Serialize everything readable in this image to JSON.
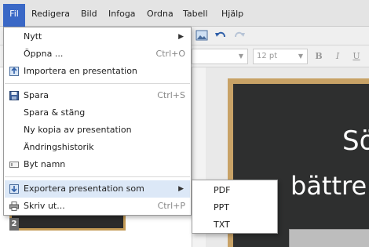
{
  "menubar": {
    "items": [
      "Fil",
      "Redigera",
      "Bild",
      "Infoga",
      "Ordna",
      "Tabell",
      "Hjälp"
    ]
  },
  "format_bar": {
    "font_size": "12 pt",
    "bold": "B",
    "italic": "I",
    "underline": "U"
  },
  "file_menu": {
    "items": [
      {
        "label": "Nytt",
        "shortcut": "",
        "submenu": true
      },
      {
        "label": "Öppna ...",
        "shortcut": "Ctrl+O"
      },
      {
        "label": "Importera en presentation",
        "shortcut": ""
      },
      {
        "label": "Spara",
        "shortcut": "Ctrl+S"
      },
      {
        "label": "Spara & stäng",
        "shortcut": ""
      },
      {
        "label": "Ny kopia av presentation",
        "shortcut": ""
      },
      {
        "label": "Ändringshistorik",
        "shortcut": ""
      },
      {
        "label": "Byt namn",
        "shortcut": ""
      },
      {
        "label": "Exportera presentation som",
        "shortcut": "",
        "submenu": true
      },
      {
        "label": "Skriv ut...",
        "shortcut": "Ctrl+P"
      }
    ]
  },
  "export_submenu": {
    "items": [
      "PDF",
      "PPT",
      "TXT"
    ]
  },
  "slide_panel": {
    "slide_number": "2"
  },
  "slide": {
    "line1": "Sö",
    "line2": "bättre"
  },
  "colors": {
    "menubar_active": "#3a68c6",
    "menu_highlight": "#dce8f7",
    "slide_bg": "#2e2f2f",
    "slide_frame": "#c8a266"
  }
}
